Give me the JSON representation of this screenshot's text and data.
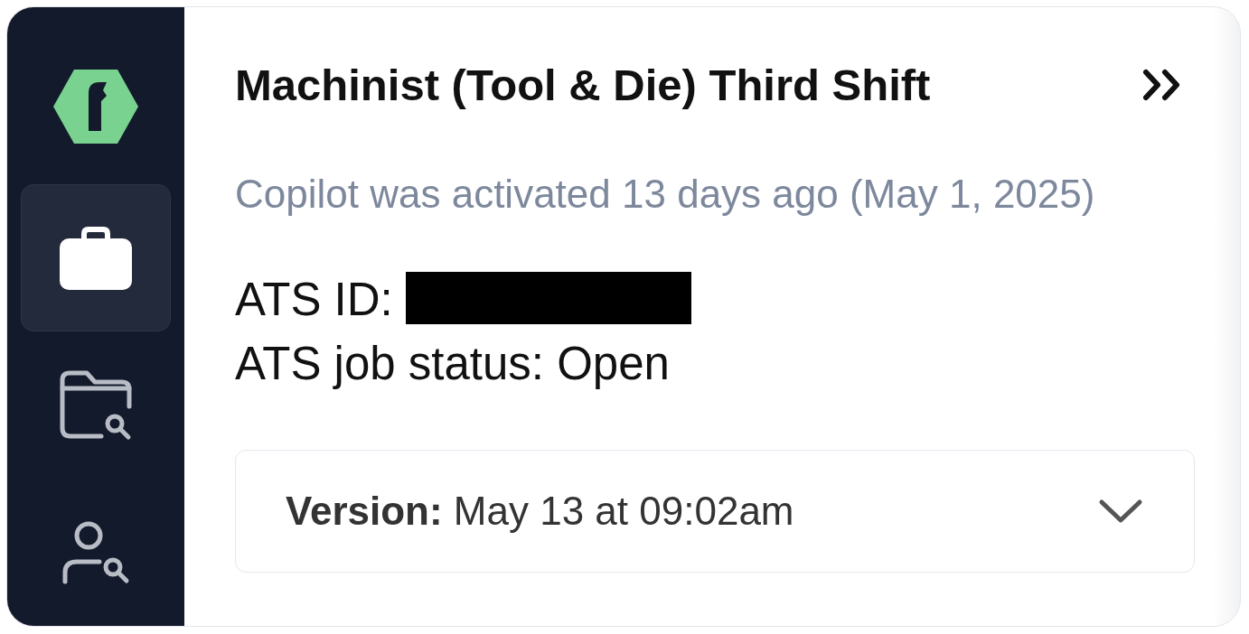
{
  "sidebar": {
    "items": [
      {
        "selected": true
      },
      {
        "selected": false
      },
      {
        "selected": false
      }
    ]
  },
  "header": {
    "title": "Machinist (Tool & Die) Third Shift"
  },
  "activation_note": "Copilot was activated 13 days ago (May 1, 2025)",
  "details": [
    {
      "text": "ATS ID:",
      "redacted": true
    },
    {
      "text": "ATS job status: Open",
      "redacted": false
    }
  ],
  "version": {
    "text": "**Version:** May 13 at 09:02am",
    "expanded": false
  }
}
